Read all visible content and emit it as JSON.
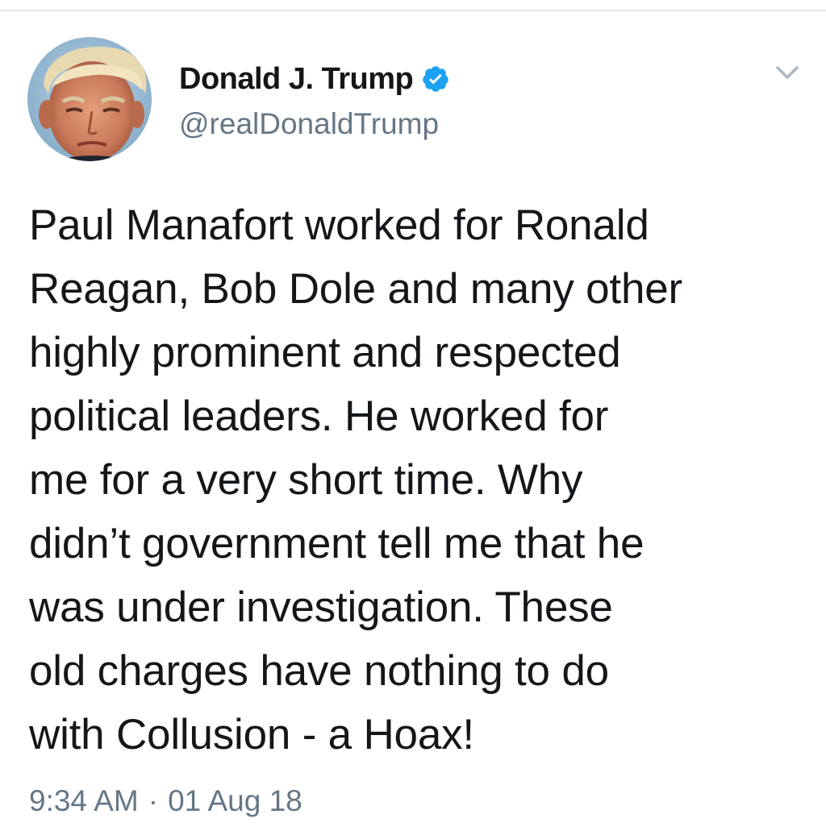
{
  "tweet": {
    "author": {
      "display_name": "Donald J. Trump",
      "handle": "@realDonaldTrump",
      "verified": true
    },
    "text": "Paul Manafort worked for Ronald\nReagan, Bob Dole and many other\nhighly prominent and respected\npolitical leaders. He worked for\nme for a very short time. Why\ndidn’t government tell me that he\nwas under investigation. These\nold charges have nothing to do\nwith Collusion - a Hoax!",
    "time": "9:34 AM",
    "separator": "·",
    "date": "01 Aug 18"
  },
  "icons": {
    "verified": "verified-badge-icon",
    "menu": "chevron-down-icon"
  },
  "colors": {
    "text_primary": "#14171a",
    "text_secondary": "#657786",
    "verified_blue": "#1da1f2",
    "chevron": "#aab8c2"
  }
}
